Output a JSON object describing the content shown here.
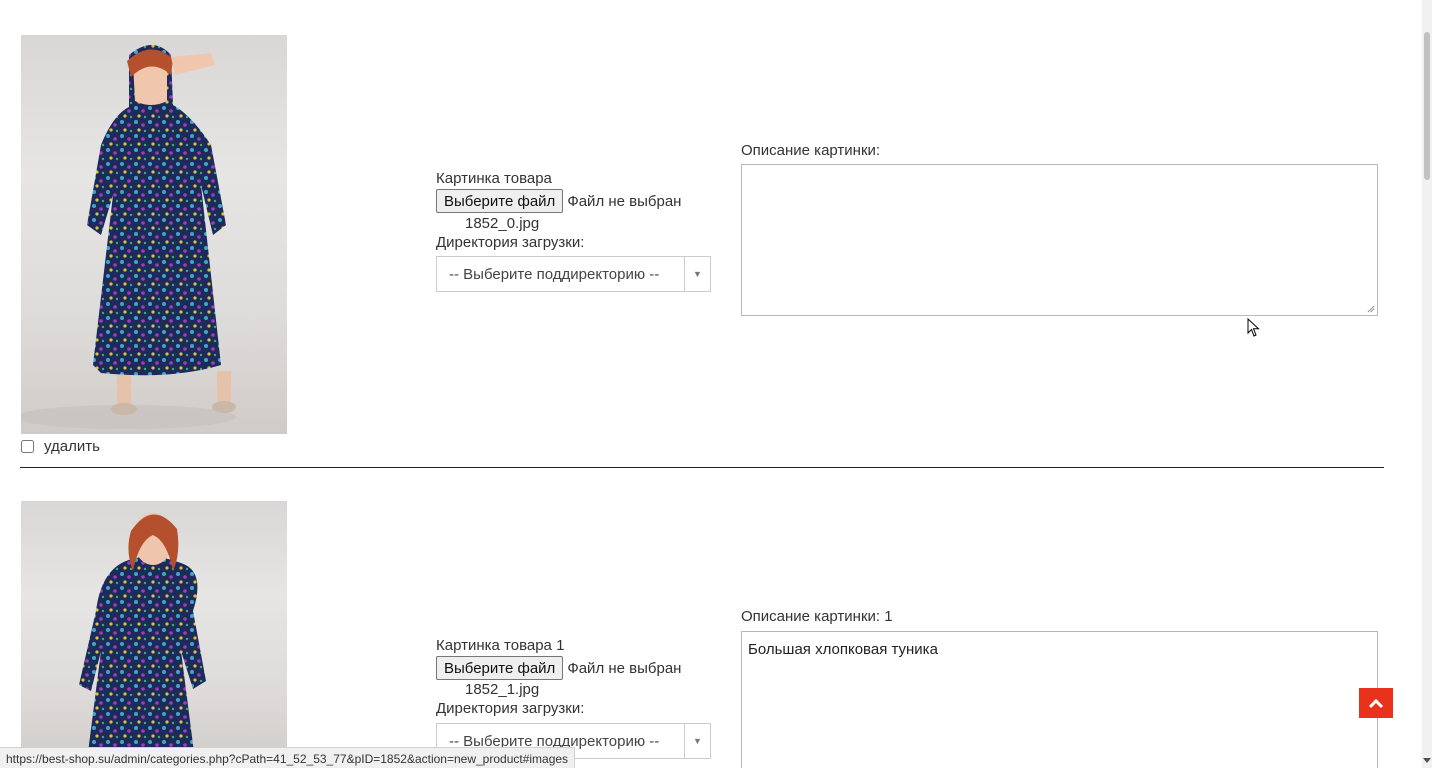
{
  "images": [
    {
      "photo_icon": "dress-photo-front",
      "picture_label": "Картинка товара",
      "choose_file_label": "Выберите файл",
      "file_status": "Файл не выбран",
      "file_name": "1852_0.jpg",
      "upload_dir_label": "Директория загрузки:",
      "subdir_placeholder": "-- Выберите поддиректорию --",
      "description_label": "Описание картинки:",
      "description_value": "",
      "delete_label": "удалить"
    },
    {
      "photo_icon": "dress-photo-second",
      "picture_label": "Картинка товара 1",
      "choose_file_label": "Выберите файл",
      "file_status": "Файл не выбран",
      "file_name": "1852_1.jpg",
      "upload_dir_label": "Директория загрузки:",
      "subdir_placeholder": "-- Выберите поддиректорию --",
      "description_label": "Описание картинки: 1",
      "description_value": "Большая хлопковая туника"
    }
  ],
  "scroll_top_icon": "chevron-up-icon",
  "status_bar_url": "https://best-shop.su/admin/categories.php?cPath=41_52_53_77&pID=1852&action=new_product#images",
  "colors": {
    "accent": "#e8321c",
    "divider": "#222222",
    "input_border": "#b8b8b8"
  }
}
